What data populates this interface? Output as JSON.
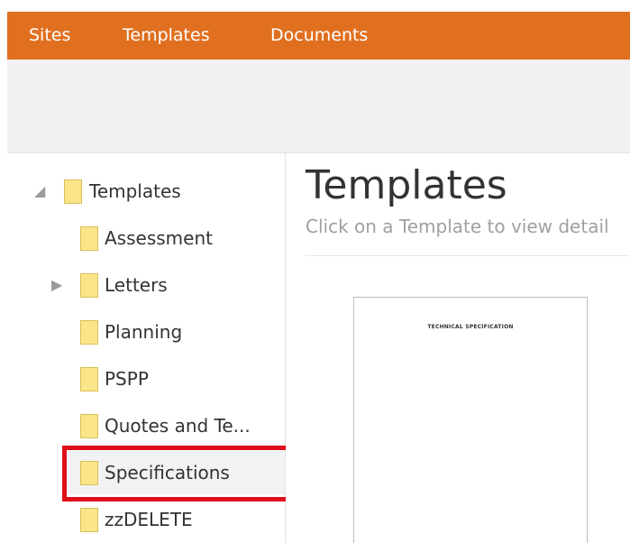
{
  "nav": {
    "sites": "Sites",
    "templates": "Templates",
    "documents": "Documents",
    "bar_color": "#e07020"
  },
  "tree": {
    "root": {
      "label": "Templates",
      "expanded": true,
      "icon": "folder-icon"
    },
    "items": [
      {
        "label": "Assessment",
        "icon": "folder-icon",
        "expandable": false
      },
      {
        "label": "Letters",
        "icon": "folder-icon",
        "expandable": true
      },
      {
        "label": "Planning",
        "icon": "folder-icon",
        "expandable": false
      },
      {
        "label": "PSPP",
        "icon": "folder-icon",
        "expandable": false
      },
      {
        "label": "Quotes and Te...",
        "icon": "folder-icon",
        "expandable": false
      },
      {
        "label": "Specifications",
        "icon": "folder-icon",
        "expandable": false,
        "selected": true
      },
      {
        "label": "zzDELETE",
        "icon": "folder-icon",
        "expandable": false
      }
    ],
    "highlight_color": "#e0101a"
  },
  "main": {
    "title": "Templates",
    "subtitle": "Click on a Template to view detail",
    "document_preview": {
      "title": "TECHNICAL SPECIFICATION"
    }
  }
}
